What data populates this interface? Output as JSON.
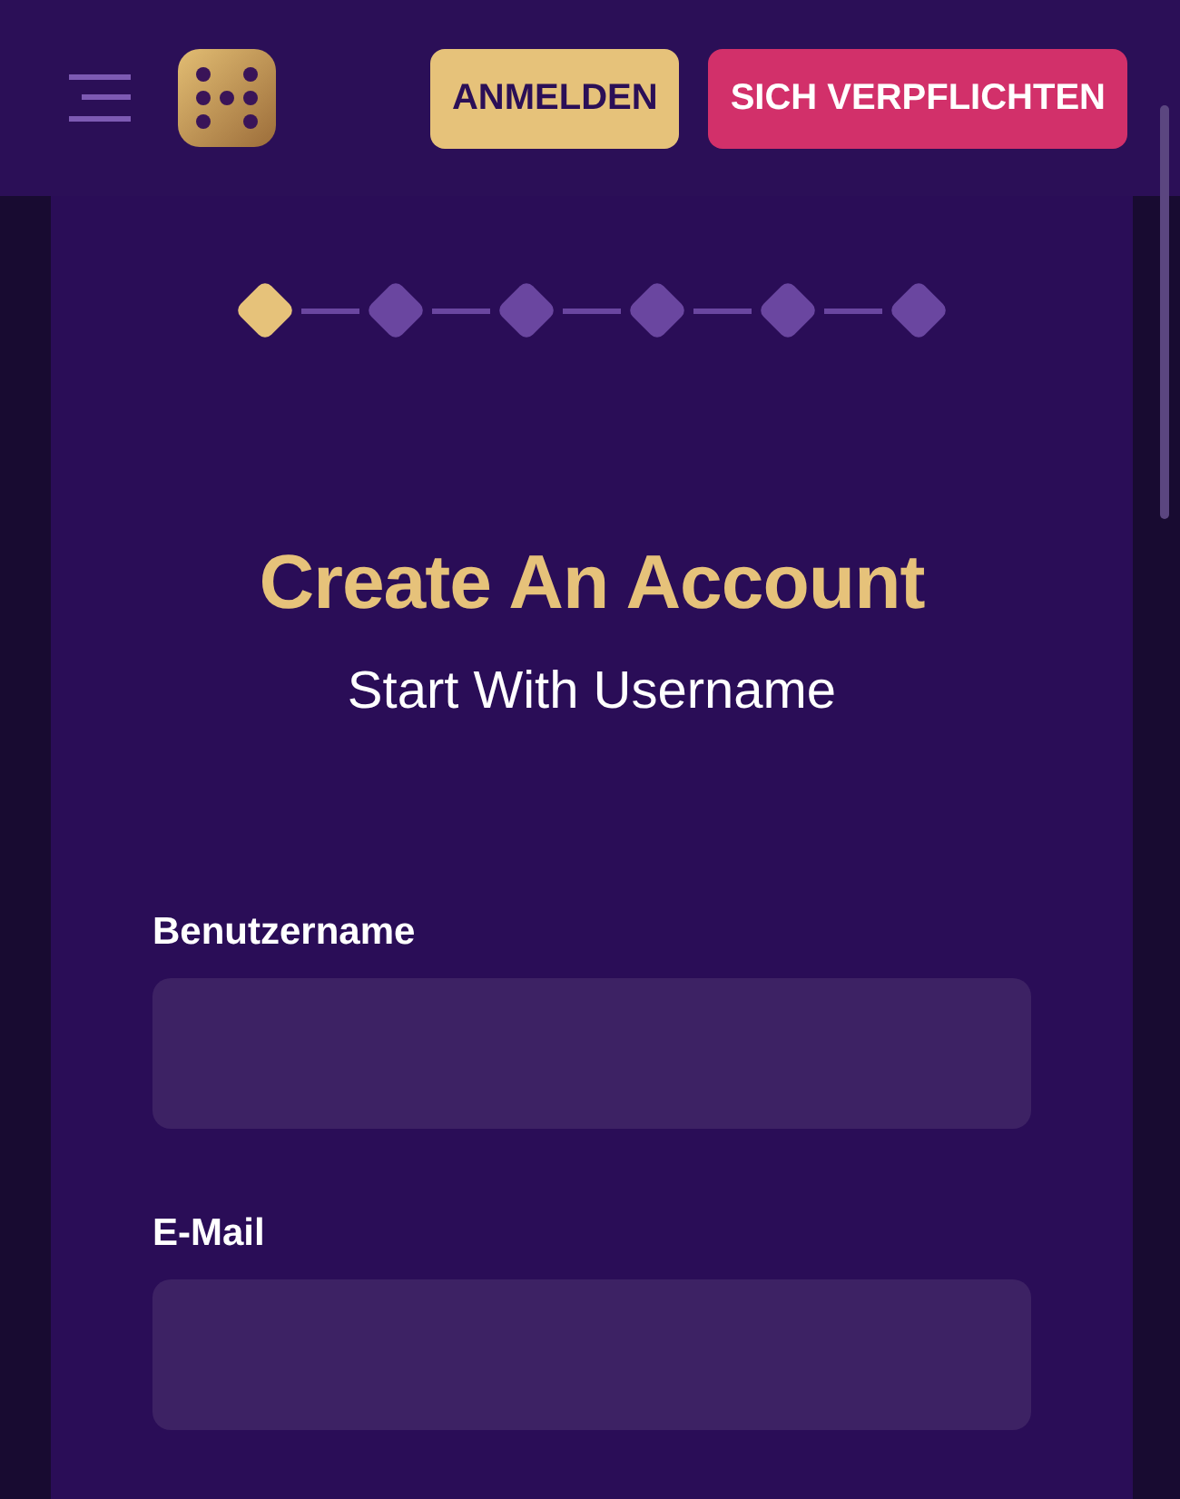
{
  "header": {
    "buttons": [
      {
        "label": "ANMELDEN",
        "kind": "secondary"
      },
      {
        "label": "SICH VERPFLICHTEN",
        "kind": "primary"
      }
    ]
  },
  "steps": [
    {
      "selected": true
    },
    {
      "selected": false
    },
    {
      "selected": false
    },
    {
      "selected": false
    },
    {
      "selected": false
    },
    {
      "selected": false
    }
  ],
  "title": "Create An Account",
  "subtitle": "Start With Username",
  "fields": [
    {
      "label": "Benutzername"
    },
    {
      "label": "E-Mail"
    }
  ]
}
